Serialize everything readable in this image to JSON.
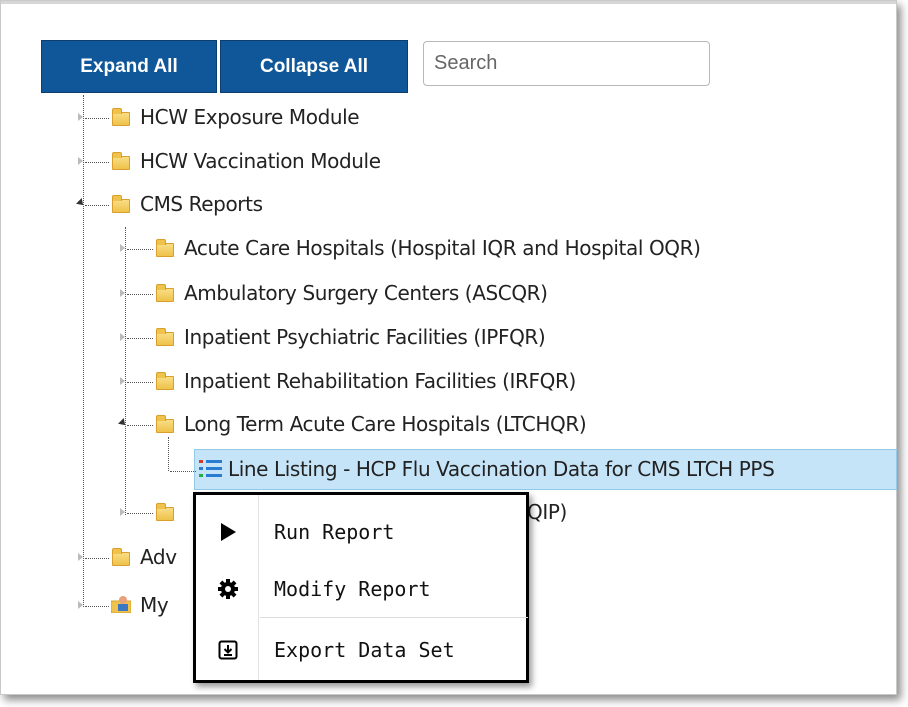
{
  "toolbar": {
    "expand_all_label": "Expand All",
    "collapse_all_label": "Collapse All",
    "search_placeholder": "Search"
  },
  "tree": {
    "items": [
      {
        "label": "HCW Exposure Module"
      },
      {
        "label": "HCW Vaccination Module"
      },
      {
        "label": "CMS Reports"
      },
      {
        "label": "Acute Care Hospitals (Hospital IQR and Hospital OQR)"
      },
      {
        "label": "Ambulatory Surgery Centers (ASCQR)"
      },
      {
        "label": "Inpatient Psychiatric Facilities (IPFQR)"
      },
      {
        "label": "Inpatient Rehabilitation Facilities (IRFQR)"
      },
      {
        "label": "Long Term Acute Care Hospitals (LTCHQR)"
      },
      {
        "label": "Line Listing - HCP Flu Vaccination Data for CMS LTCH PPS"
      },
      {
        "label": "QIP)"
      },
      {
        "label": "Adv"
      },
      {
        "label": "My"
      }
    ]
  },
  "context_menu": {
    "items": [
      {
        "label": "Run Report",
        "icon": "play-icon"
      },
      {
        "label": "Modify Report",
        "icon": "gear-icon"
      },
      {
        "label": "Export Data Set",
        "icon": "export-icon"
      }
    ]
  },
  "colors": {
    "button_bg": "#0f5798",
    "selection_bg": "#c6e4f7",
    "folder": "#efc24b"
  }
}
